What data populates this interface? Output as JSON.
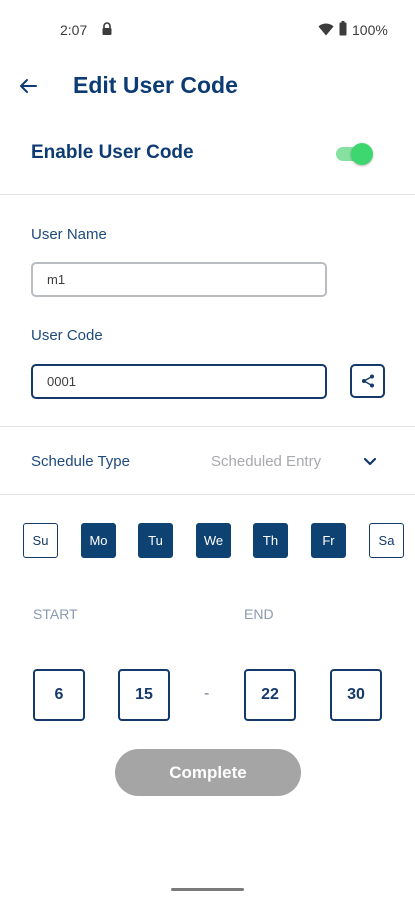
{
  "status_bar": {
    "time": "2:07",
    "battery": "100%"
  },
  "header": {
    "title": "Edit User Code",
    "back_icon": "arrow-left-icon"
  },
  "enable": {
    "label": "Enable User Code",
    "enabled": true,
    "toggle_color": "#3ed66e"
  },
  "user_name": {
    "label": "User Name",
    "value": "m1"
  },
  "user_code": {
    "label": "User Code",
    "value": "0001",
    "share_icon": "share-icon"
  },
  "schedule": {
    "label": "Schedule Type",
    "value": "Scheduled Entry",
    "chevron_icon": "chevron-down-icon"
  },
  "days": [
    {
      "label": "Su",
      "selected": false
    },
    {
      "label": "Mo",
      "selected": true
    },
    {
      "label": "Tu",
      "selected": true
    },
    {
      "label": "We",
      "selected": true
    },
    {
      "label": "Th",
      "selected": true
    },
    {
      "label": "Fr",
      "selected": true
    },
    {
      "label": "Sa",
      "selected": false
    }
  ],
  "time_range": {
    "start_label": "START",
    "end_label": "END",
    "start_hour": "6",
    "start_minute": "15",
    "separator": "-",
    "end_hour": "22",
    "end_minute": "30"
  },
  "complete_button": "Complete",
  "colors": {
    "primary": "#0d3b73",
    "day_selected": "#0d4272",
    "button_disabled": "#a5a5a5"
  }
}
